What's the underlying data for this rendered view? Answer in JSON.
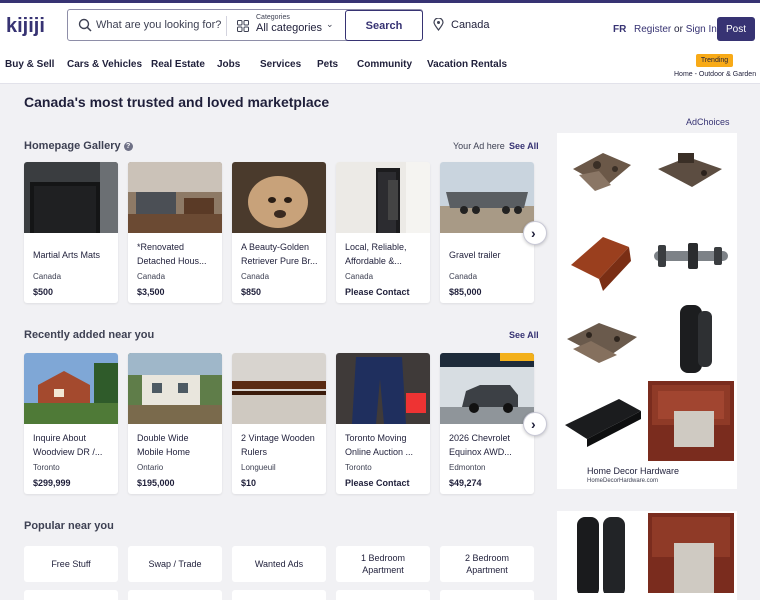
{
  "header": {
    "logo_text": "kijiji",
    "search_placeholder": "What are you looking for?",
    "category_label": "Categories",
    "category_value": "All categories",
    "search_button": "Search",
    "location": "Canada",
    "language": "FR",
    "register": "Register",
    "or": "or",
    "sign_in": "Sign In",
    "post_button": "Post"
  },
  "nav": {
    "items": [
      "Buy & Sell",
      "Cars & Vehicles",
      "Real Estate",
      "Jobs",
      "Services",
      "Pets",
      "Community",
      "Vacation Rentals"
    ],
    "trending_badge": "Trending",
    "trending_link": "Home - Outdoor & Garden"
  },
  "main": {
    "title": "Canada's most trusted and loved marketplace",
    "gallery": {
      "title": "Homepage Gallery",
      "help": "?",
      "your_ad": "Your Ad here",
      "see_all": "See All",
      "cards": [
        {
          "title": "Martial Arts Mats",
          "location": "Canada",
          "price": "$500"
        },
        {
          "title": "*Renovated Detached Hous...",
          "location": "Canada",
          "price": "$3,500"
        },
        {
          "title": "A Beauty-Golden Retriever Pure Br...",
          "location": "Canada",
          "price": "$850"
        },
        {
          "title": "Local, Reliable, Affordable &...",
          "location": "Canada",
          "price": "Please Contact"
        },
        {
          "title": "Gravel trailer",
          "location": "Canada",
          "price": "$85,000"
        }
      ]
    },
    "recent": {
      "title": "Recently added near you",
      "see_all": "See All",
      "cards": [
        {
          "title": "Inquire About Woodview DR /...",
          "location": "Toronto",
          "price": "$299,999"
        },
        {
          "title": "Double Wide Mobile Home",
          "location": "Ontario",
          "price": "$195,000"
        },
        {
          "title": "2 Vintage Wooden Rulers",
          "location": "Longueuil",
          "price": "$10"
        },
        {
          "title": "Toronto Moving Online Auction ...",
          "location": "Toronto",
          "price": "Please Contact"
        },
        {
          "title": "2026 Chevrolet Equinox AWD...",
          "location": "Edmonton",
          "price": "$49,274"
        }
      ]
    },
    "popular": {
      "title": "Popular near you",
      "chips": [
        "Free Stuff",
        "Swap / Trade",
        "Wanted Ads",
        "1 Bedroom Apartment",
        "2 Bedroom Apartment"
      ]
    }
  },
  "ads": {
    "adchoices": "AdChoices",
    "advertiser": "Home Decor Hardware",
    "advertiser_url": "HomeDecorHardware.com"
  },
  "icons": {
    "next": "›",
    "chevron": "⌄"
  }
}
